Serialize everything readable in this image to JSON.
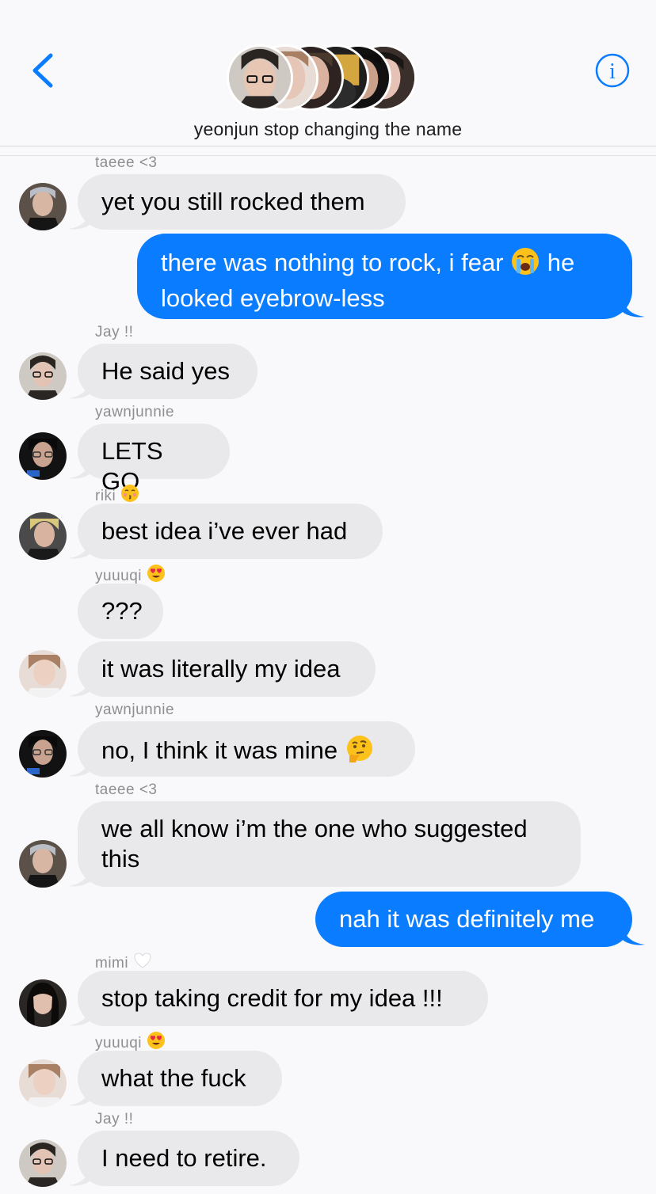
{
  "header": {
    "title": "yeonjun stop changing the name",
    "back_icon": "chevron-left-icon",
    "info_icon": "info-icon",
    "accent": "#0a7cff"
  },
  "messages": [
    {
      "sender": "taeee <3",
      "text": "yet you still rocked them",
      "direction": "incoming"
    },
    {
      "text_a": "there was nothing to rock, i fear ",
      "emoji": "loudly-crying-face",
      "text_b": " he\nlooked eyebrow-less",
      "direction": "outgoing"
    },
    {
      "sender": "Jay !!",
      "text": "He said yes",
      "direction": "incoming"
    },
    {
      "sender": "yawnjunnie",
      "text": "LETS GO",
      "direction": "incoming"
    },
    {
      "sender": "riki",
      "sender_emoji": "kissing-face",
      "text": "best idea i’ve ever had",
      "direction": "incoming"
    },
    {
      "sender": "yuuuqi",
      "sender_emoji": "heart-eyes-face",
      "text": "???",
      "direction": "incoming"
    },
    {
      "text": "it was literally my idea",
      "direction": "incoming"
    },
    {
      "sender": "yawnjunnie",
      "text": "no, I think it was mine ",
      "emoji": "thinking-face",
      "direction": "incoming"
    },
    {
      "sender": "taeee <3",
      "text": "we all know i’m the one who suggested\nthis",
      "direction": "incoming"
    },
    {
      "text": "nah it was definitely me",
      "direction": "outgoing"
    },
    {
      "sender": "mimi",
      "sender_emoji": "white-heart",
      "text": "stop taking credit for my idea !!!",
      "direction": "incoming"
    },
    {
      "sender": "yuuuqi",
      "sender_emoji": "heart-eyes-face",
      "text": "what the fuck",
      "direction": "incoming"
    },
    {
      "sender": "Jay !!",
      "text": "I need to retire.",
      "direction": "incoming"
    }
  ]
}
